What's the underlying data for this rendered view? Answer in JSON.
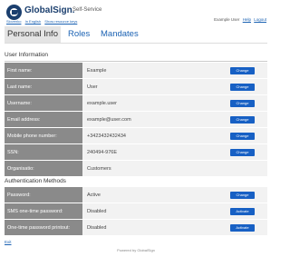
{
  "header": {
    "brand": "GlobalSign.",
    "service": "Self-Service",
    "links": [
      "Slovenko",
      "In English",
      "Show resource keys"
    ],
    "user": "Example User",
    "help": "Help",
    "logout": "Logout"
  },
  "tabs": [
    "Personal Info",
    "Roles",
    "Mandates"
  ],
  "user_info": {
    "title": "User Information",
    "rows": [
      {
        "label": "First name:",
        "value": "Example",
        "action": "Change"
      },
      {
        "label": "Last name:",
        "value": "User",
        "action": "Change"
      },
      {
        "label": "Username:",
        "value": "example.user",
        "action": "Change"
      },
      {
        "label": "Email address:",
        "value": "example@user.com",
        "action": "Change"
      },
      {
        "label": "Mobile phone number:",
        "value": "+3423432432434",
        "action": "Change"
      },
      {
        "label": "SSN:",
        "value": "240494-976E",
        "action": "Change"
      },
      {
        "label": "Organisatio:",
        "value": "Customers",
        "action": ""
      }
    ]
  },
  "auth": {
    "title": "Authentication Methods",
    "rows": [
      {
        "label": "Password:",
        "value": "Active",
        "action": "Change"
      },
      {
        "label": "SMS one-time password:",
        "value": "Disabled",
        "action": "Activate"
      },
      {
        "label": "One-time password printout:",
        "value": "Disabled",
        "action": "Activate"
      }
    ]
  },
  "exit": "Exit",
  "footer": "Powered by GlobalSign",
  "colors": {
    "brand": "#1b3f6e",
    "button": "#1760c4",
    "label_bg": "#8a8a8a",
    "link": "#1b62b3"
  }
}
